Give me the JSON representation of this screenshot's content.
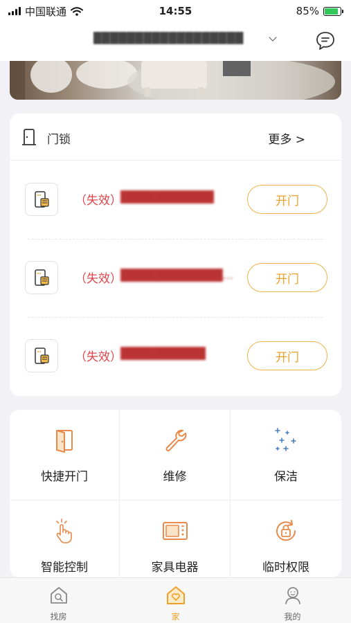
{
  "status_bar": {
    "carrier": "中国联通",
    "time": "14:55",
    "battery": "85%",
    "battery_level": 0.85
  },
  "header": {
    "title": "██████████████████"
  },
  "lock_section": {
    "title": "门锁",
    "more": "更多 >",
    "items": [
      {
        "status": "（失效）",
        "name": "███████████",
        "button": "开门"
      },
      {
        "status": "（失效）",
        "name": "████████████...",
        "button": "开门"
      },
      {
        "status": "（失效）",
        "name": "██████████",
        "button": "开门"
      }
    ]
  },
  "services": [
    {
      "label": "快捷开门",
      "icon": "quick-open-door-icon"
    },
    {
      "label": "维修",
      "icon": "wrench-icon"
    },
    {
      "label": "保洁",
      "icon": "sparkle-icon"
    },
    {
      "label": "智能控制",
      "icon": "tap-hand-icon"
    },
    {
      "label": "家具电器",
      "icon": "microwave-icon"
    },
    {
      "label": "临时权限",
      "icon": "temporary-lock-icon"
    }
  ],
  "tabbar": {
    "items": [
      {
        "label": "找房",
        "icon": "house-search-icon",
        "active": false
      },
      {
        "label": "家",
        "icon": "home-heart-icon",
        "active": true
      },
      {
        "label": "我的",
        "icon": "person-icon",
        "active": false
      }
    ]
  },
  "colors": {
    "accent": "#f0a028",
    "status_invalid": "#e0444a",
    "icon_orange": "#e8894a",
    "icon_blue": "#4a7fc0"
  }
}
